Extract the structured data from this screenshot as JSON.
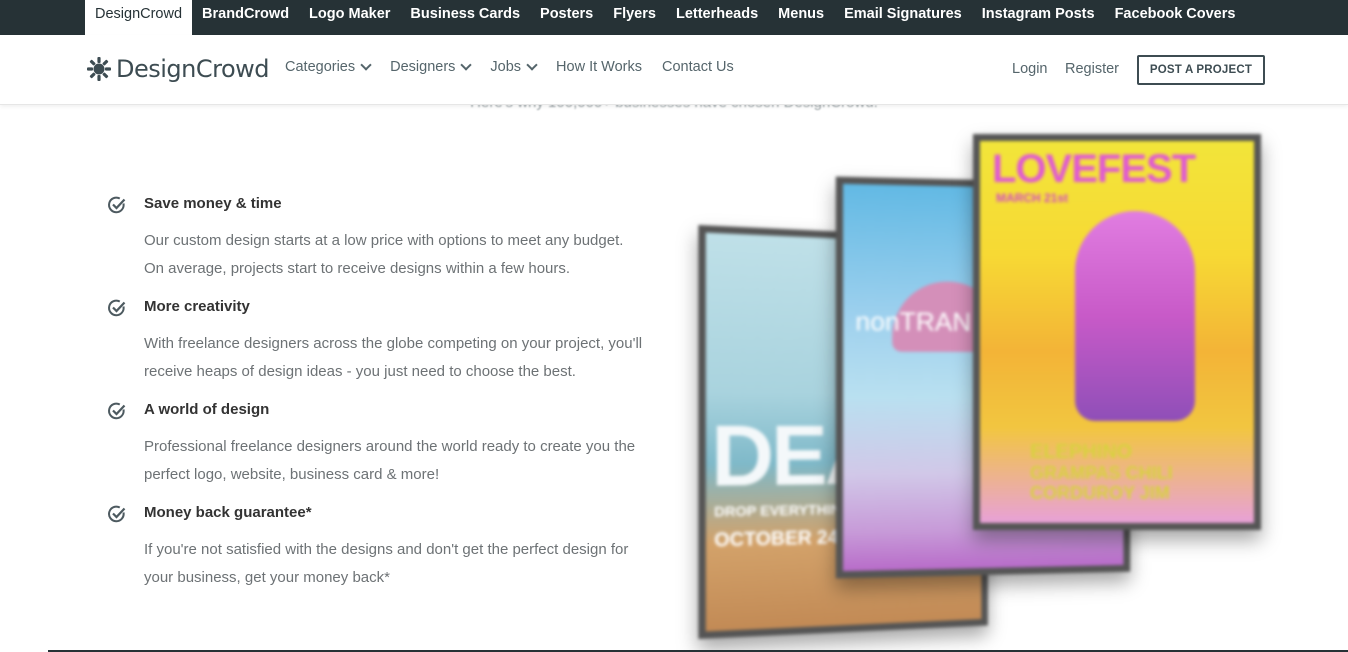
{
  "topbar": {
    "items": [
      "DesignCrowd",
      "BrandCrowd",
      "Logo Maker",
      "Business Cards",
      "Posters",
      "Flyers",
      "Letterheads",
      "Menus",
      "Email Signatures",
      "Instagram Posts",
      "Facebook Covers"
    ]
  },
  "nav": {
    "logo_text": "DesignCrowd",
    "links": [
      "Categories",
      "Designers",
      "Jobs",
      "How It Works",
      "Contact Us"
    ],
    "login": "Login",
    "register": "Register",
    "post_project": "POST A PROJECT"
  },
  "behind_text": "Here's why 100,000+ businesses have chosen DesignCrowd.",
  "features": [
    {
      "title": "Save money & time",
      "line1": "Our custom design starts at a low price with options to meet any budget.",
      "line2": "On average, projects start to receive designs within a few hours."
    },
    {
      "title": "More creativity",
      "line1": "With freelance designers across the globe competing on your project, you'll",
      "line2": "receive heaps of design ideas - you just need to choose the best."
    },
    {
      "title": "A world of design",
      "line1": "Professional freelance designers around the world ready to create you the",
      "line2": "perfect logo, website, business card & more!"
    },
    {
      "title": "Money back guarantee*",
      "line1": "If you're not satisfied with the designs and don't get the perfect design for",
      "line2": "your business, get your money back*"
    }
  ],
  "posters": {
    "p1_title": "DEA",
    "p1_sub": "DROP EVERYTHING AND",
    "p1_date": "OCTOBER 24,2016",
    "p2_title": "nonTRAN",
    "p3_title": "LOVEFEST",
    "p3_date": "MARCH 21st",
    "p3_band1": "ELEPHINO",
    "p3_band2": "GRAMPAS CHILI",
    "p3_band3": "CORDUROY JIM"
  },
  "colors": {
    "dark": "#263236",
    "text": "#333333",
    "muted": "#6d7275"
  }
}
